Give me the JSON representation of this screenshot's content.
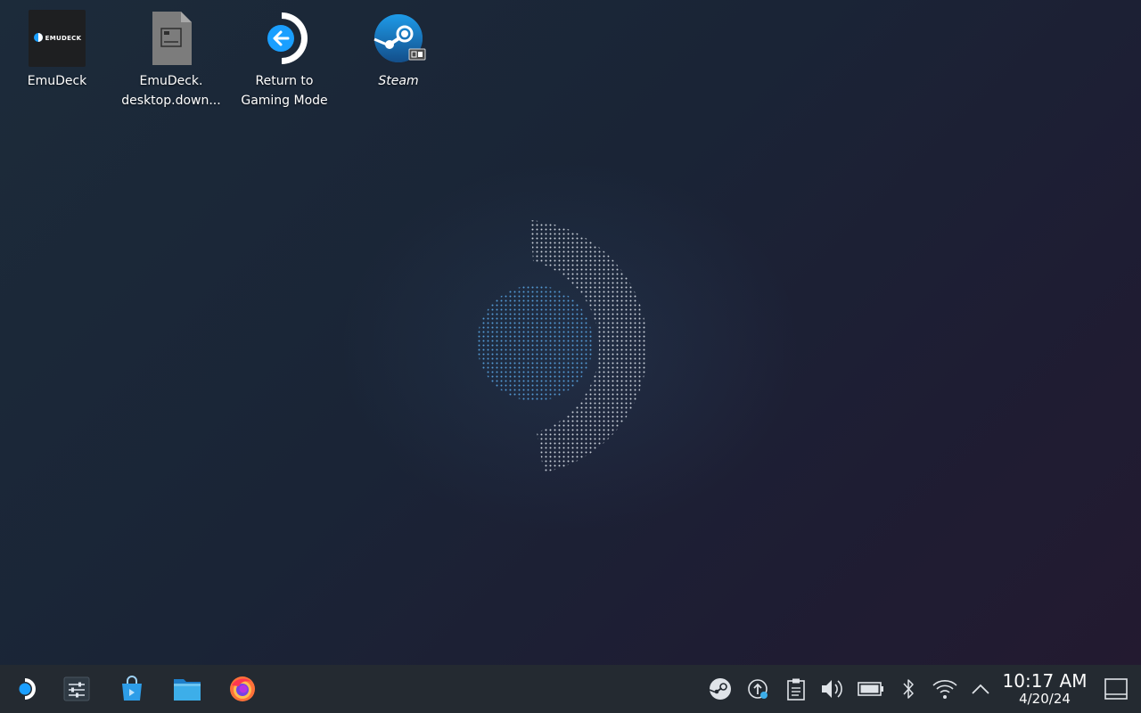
{
  "desktop": {
    "icons": [
      {
        "label": "EmuDeck",
        "icon": "emudeck-app-icon",
        "logo_text": "EMUDECK"
      },
      {
        "label": "EmuDeck.\ndesktop.down...",
        "icon": "file-icon"
      },
      {
        "label": "Return to\nGaming Mode",
        "icon": "return-arrow-icon"
      },
      {
        "label": "Steam",
        "icon": "steam-icon"
      }
    ]
  },
  "taskbar": {
    "launchers": [
      {
        "icon": "steamos-start-icon"
      },
      {
        "icon": "system-settings-icon"
      },
      {
        "icon": "discover-store-icon"
      },
      {
        "icon": "dolphin-file-manager-icon"
      },
      {
        "icon": "firefox-icon"
      }
    ],
    "tray": [
      {
        "icon": "steam-tray-icon"
      },
      {
        "icon": "update-tray-icon"
      },
      {
        "icon": "clipboard-icon"
      },
      {
        "icon": "volume-icon"
      },
      {
        "icon": "battery-icon"
      },
      {
        "icon": "bluetooth-icon"
      },
      {
        "icon": "wifi-icon"
      },
      {
        "icon": "chevron-up-icon"
      }
    ],
    "clock": {
      "time": "10:17 AM",
      "date": "4/20/24"
    },
    "show_desktop_icon": "show-desktop-icon"
  },
  "colors": {
    "taskbar_bg": "#242a31",
    "steam_blue": "#1a9fff",
    "firefox_orange": "#ff7139"
  }
}
